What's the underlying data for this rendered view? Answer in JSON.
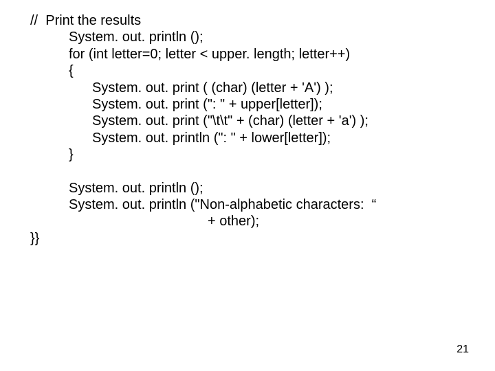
{
  "code": {
    "l1": "//  Print the results",
    "l2": "System. out. println ();",
    "l3": "for (int letter=0; letter < upper. length; letter++)",
    "l4": "{",
    "l5": "System. out. print ( (char) (letter + 'A') );",
    "l6": "System. out. print (\": \" + upper[letter]);",
    "l7": "System. out. print (\"\\t\\t\" + (char) (letter + 'a') );",
    "l8": "System. out. println (\": \" + lower[letter]);",
    "l9": "}",
    "l10": "System. out. println ();",
    "l11": "System. out. println (\"Non-alphabetic characters:  “",
    "l12": "+ other);",
    "l13": "}}"
  },
  "page_number": "21"
}
